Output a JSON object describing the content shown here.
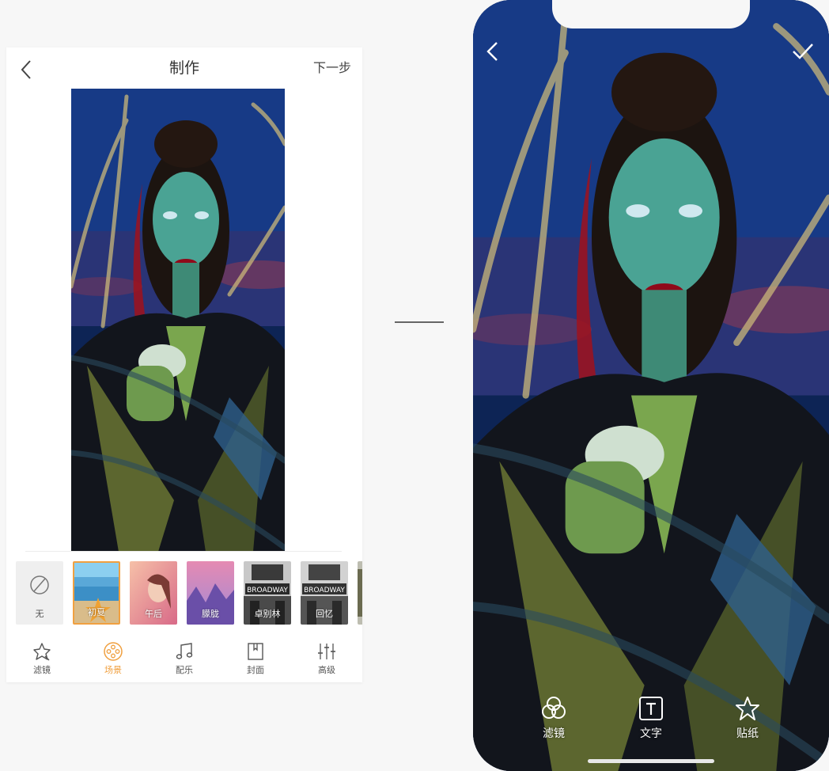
{
  "editor": {
    "title": "制作",
    "next_label": "下一步",
    "scenes": [
      {
        "label": "无",
        "icon": "none-icon",
        "selected": false
      },
      {
        "label": "初夏",
        "icon": "starfish-beach-thumb",
        "selected": true
      },
      {
        "label": "午后",
        "icon": "portrait-thumb",
        "selected": false
      },
      {
        "label": "朦胧",
        "icon": "mountain-thumb",
        "selected": false
      },
      {
        "label": "卓别林",
        "icon": "broadway-thumb",
        "selected": false
      },
      {
        "label": "回忆",
        "icon": "broadway-thumb",
        "selected": false
      }
    ],
    "tabs": [
      {
        "label": "滤镜",
        "icon": "filter-icon",
        "active": false
      },
      {
        "label": "场景",
        "icon": "scene-reel-icon",
        "active": true
      },
      {
        "label": "配乐",
        "icon": "music-note-icon",
        "active": false
      },
      {
        "label": "封面",
        "icon": "cover-bookmark-icon",
        "active": false
      },
      {
        "label": "高级",
        "icon": "sliders-icon",
        "active": false
      }
    ],
    "thumb_sign": "BROADWAY",
    "accent_color": "#f0a040"
  },
  "phone": {
    "tools": [
      {
        "label": "滤镜",
        "icon": "filter-circles-icon"
      },
      {
        "label": "文字",
        "icon": "text-box-icon"
      },
      {
        "label": "贴纸",
        "icon": "star-sticker-icon"
      }
    ]
  }
}
